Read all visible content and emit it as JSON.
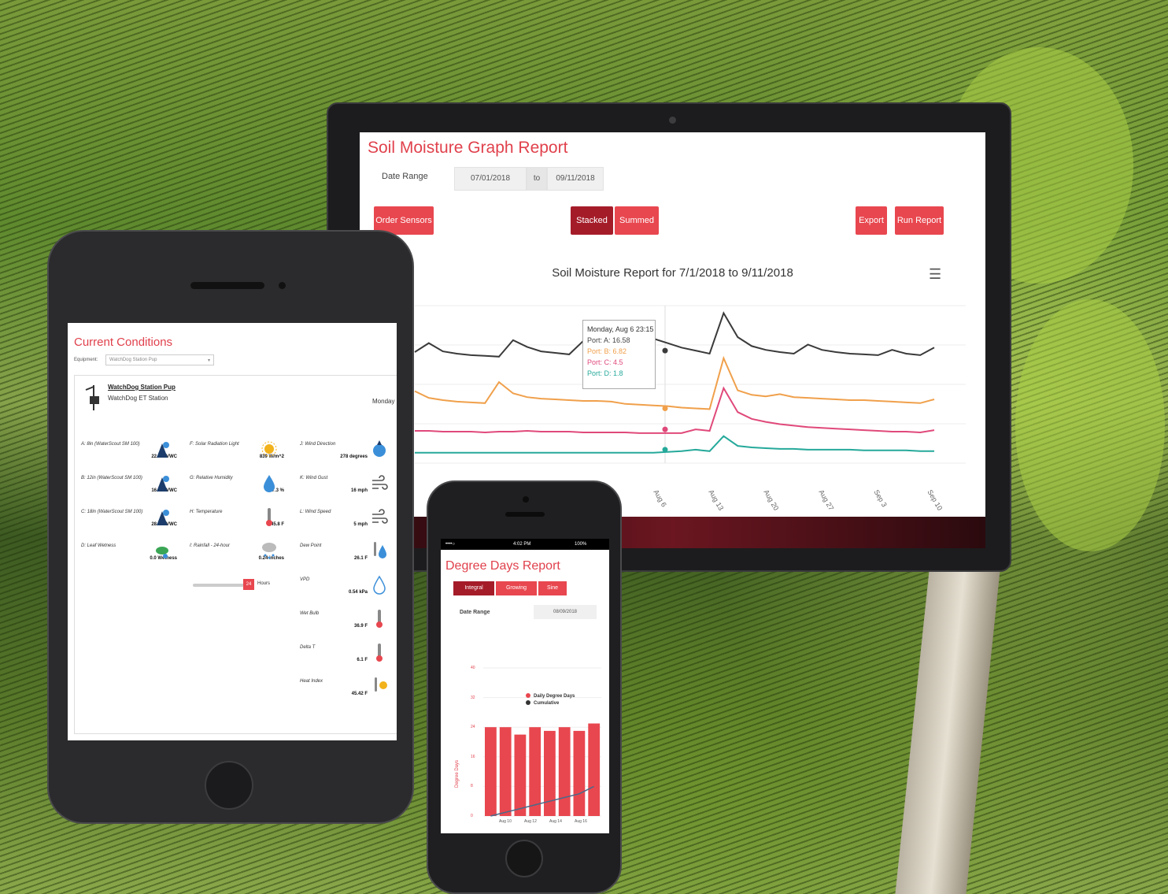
{
  "colors": {
    "accent": "#e8474f",
    "accent_dark": "#a51c29",
    "title_red": "#e0414c"
  },
  "monitor": {
    "title": "Soil Moisture Graph Report",
    "date_range_label": "Date Range",
    "date_from": "07/01/2018",
    "date_to_label": "to",
    "date_to": "09/11/2018",
    "buttons": {
      "order_sensors": "Order Sensors",
      "stacked": "Stacked",
      "summed": "Summed",
      "export": "Export",
      "run_report": "Run Report"
    },
    "chart_title": "Soil Moisture Report for 7/1/2018 to 9/11/2018",
    "menu_icon": "hamburger-menu-icon",
    "tooltip": {
      "header": "Monday, Aug 6 23:15",
      "lines": [
        "Port: A: 16.58",
        "Port: B: 6.82",
        "Port: C: 4.5",
        "Port: D: 1.8"
      ]
    },
    "x_tick_labels": [
      "Aug 6",
      "Aug 13",
      "Aug 20",
      "Aug 27",
      "Sep 3",
      "Sep 10"
    ]
  },
  "chart_data": [
    {
      "type": "line",
      "title": "Soil Moisture Report for 7/1/2018 to 9/11/2018",
      "x_tick_labels": [
        "Aug 6",
        "Aug 13",
        "Aug 20",
        "Aug 27",
        "Sep 3",
        "Sep 10"
      ],
      "series": [
        {
          "name": "Port: A",
          "color": "#3a3a3a",
          "values": [
            14.8,
            16.0,
            14.9,
            14.6,
            14.4,
            14.3,
            14.2,
            16.4,
            15.5,
            14.9,
            14.7,
            14.5,
            16.3,
            15.9,
            15.4,
            14.8,
            14.5,
            16.6,
            16.0,
            15.4,
            15.0,
            14.6,
            20.0,
            16.8,
            15.6,
            15.1,
            14.8,
            14.6,
            15.8,
            15.1,
            14.8,
            14.6,
            14.5,
            14.4,
            15.1,
            14.6,
            14.4,
            15.4
          ]
        },
        {
          "name": "Port: B",
          "color": "#f0a04b",
          "values": [
            9.6,
            8.7,
            8.4,
            8.2,
            8.1,
            8.0,
            10.8,
            9.3,
            8.8,
            8.6,
            8.5,
            8.4,
            8.3,
            8.3,
            8.2,
            7.9,
            7.8,
            7.7,
            7.6,
            7.4,
            7.3,
            7.2,
            14.0,
            9.7,
            9.1,
            8.9,
            9.2,
            8.8,
            8.7,
            8.6,
            8.5,
            8.4,
            8.4,
            8.3,
            8.2,
            8.1,
            8.0,
            8.5
          ]
        },
        {
          "name": "Port: C",
          "color": "#e0497a",
          "values": [
            4.3,
            4.3,
            4.2,
            4.2,
            4.2,
            4.1,
            4.2,
            4.2,
            4.3,
            4.2,
            4.2,
            4.2,
            4.1,
            4.1,
            4.1,
            4.1,
            4.0,
            4.0,
            4.0,
            4.0,
            4.5,
            4.3,
            10.0,
            6.8,
            5.9,
            5.5,
            5.2,
            5.0,
            4.8,
            4.7,
            4.6,
            4.5,
            4.4,
            4.3,
            4.2,
            4.2,
            4.1,
            4.4
          ]
        },
        {
          "name": "Port: D",
          "color": "#25a99a",
          "values": [
            1.4,
            1.4,
            1.4,
            1.4,
            1.4,
            1.4,
            1.4,
            1.4,
            1.4,
            1.4,
            1.4,
            1.4,
            1.4,
            1.4,
            1.4,
            1.4,
            1.4,
            1.4,
            1.5,
            1.6,
            1.8,
            1.6,
            3.6,
            2.3,
            2.1,
            2.0,
            1.9,
            1.9,
            1.8,
            1.8,
            1.8,
            1.8,
            1.7,
            1.7,
            1.7,
            1.7,
            1.6,
            1.6
          ]
        }
      ]
    },
    {
      "type": "bar",
      "title": "",
      "ylabel": "Degree Days",
      "ylim": [
        0,
        40
      ],
      "y_ticks": [
        0,
        8,
        16,
        24,
        32,
        40
      ],
      "x_tick_labels": [
        "Aug 10",
        "Aug 12",
        "Aug 14",
        "Aug 16"
      ],
      "legend": [
        "Daily Degree Days",
        "Cumulative"
      ],
      "series": [
        {
          "name": "Daily Degree Days",
          "color": "#e8474f",
          "values": [
            24,
            24,
            22,
            24,
            23,
            24,
            23,
            25
          ]
        },
        {
          "name": "Cumulative",
          "color": "#4a6a8a",
          "values": [
            0,
            1,
            2,
            3,
            4,
            5,
            6,
            8
          ]
        }
      ]
    }
  ],
  "tablet": {
    "title": "Current Conditions",
    "equipment_label": "Equipment:",
    "equipment_value": "WatchDog Station Pup",
    "station_name": "WatchDog Station Pup",
    "station_type": "WatchDog ET Station",
    "day": "Monday",
    "hours_value": "24",
    "hours_label": "Hours",
    "sensors": [
      {
        "label": "A: 8in (WaterScout SM 100)",
        "value": "22.9 %VWC",
        "icon": "soil-moisture-icon"
      },
      {
        "label": "B: 12in (WaterScout SM 100)",
        "value": "16.1 %VWC",
        "icon": "soil-moisture-icon"
      },
      {
        "label": "C: 18in (WaterScout SM 100)",
        "value": "28.9 %VWC",
        "icon": "soil-moisture-icon"
      },
      {
        "label": "D: Leaf Wetness",
        "value": "0.0 Wetness",
        "icon": "leaf-icon"
      },
      {
        "label": "F: Solar Radiation Light",
        "value": "839 W/m^2",
        "icon": "sun-icon"
      },
      {
        "label": "G: Relative Humidity",
        "value": "47.3 %",
        "icon": "humidity-drop-icon"
      },
      {
        "label": "H: Temperature",
        "value": "45.8 F",
        "icon": "thermometer-icon"
      },
      {
        "label": "I: Rainfall - 24-hour",
        "value": "0.24 inches",
        "icon": "rain-cloud-icon"
      },
      {
        "label": "J: Wind Direction",
        "value": "278 degrees",
        "icon": "compass-icon"
      },
      {
        "label": "K: Wind Gust",
        "value": "16 mph",
        "icon": "wind-icon"
      },
      {
        "label": "L: Wind Speed",
        "value": "5 mph",
        "icon": "wind-icon"
      },
      {
        "label": "Dew Point",
        "value": "26.1 F",
        "icon": "dew-point-icon"
      },
      {
        "label": "VPD",
        "value": "0.54 kPa",
        "icon": "vpd-drop-icon"
      },
      {
        "label": "Wet Bulb",
        "value": "36.9 F",
        "icon": "thermometer-icon"
      },
      {
        "label": "Delta T",
        "value": "6.1 F",
        "icon": "thermometer-icon"
      },
      {
        "label": "Heat Index",
        "value": "45.42 F",
        "icon": "heat-index-icon"
      }
    ]
  },
  "phone": {
    "status_left": "••••○",
    "status_time": "4:02 PM",
    "status_right": "100%",
    "title": "Degree Days Report",
    "tabs": [
      "Integral",
      "Growing",
      "Sine"
    ],
    "date_range_label": "Date Range",
    "date_value": "08/09/2018"
  }
}
